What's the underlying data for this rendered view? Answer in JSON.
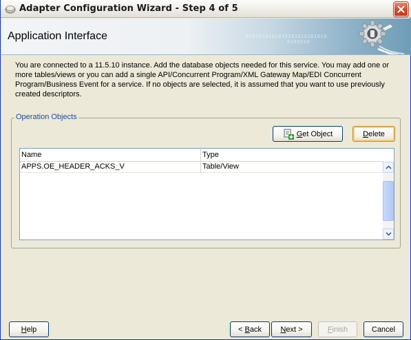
{
  "window": {
    "title": "Adapter Configuration Wizard - Step 4 of 5"
  },
  "banner": {
    "title": "Application Interface",
    "binary_text": "0101010101010101010101010",
    "binary_text_2": "0101010"
  },
  "description": "You are connected to a 11.5.10 instance. Add the database objects needed for this service. You may add one or more tables/views or you can add a single API/Concurrent Program/XML Gateway Map/EDI Concurrent Program/Business Event for a service. If no objects are selected, it is assumed that you want to use previously created descriptors.",
  "operation_objects": {
    "legend": "Operation Objects",
    "get_object_label": "Get Object",
    "get_object_mnemonic": "G",
    "get_object_rest": "et Object",
    "delete_label": "Delete",
    "delete_mnemonic": "D",
    "delete_rest": "elete",
    "table": {
      "columns": [
        "Name",
        "Type"
      ],
      "rows": [
        {
          "name": "APPS.OE_HEADER_ACKS_V",
          "type": "Table/View"
        }
      ]
    }
  },
  "footer": {
    "help_mnemonic": "H",
    "help_rest": "elp",
    "back_prefix": "< ",
    "back_mnemonic": "B",
    "back_rest": "ack",
    "next_mnemonic": "N",
    "next_rest": "ext >",
    "finish_mnemonic": "F",
    "finish_rest": "inish",
    "cancel_label": "Cancel"
  },
  "icons": {
    "title_icon": "oracle-jdeveloper-icon",
    "close_icon": "close-icon",
    "banner_icon": "plug-gear-icon",
    "get_object_icon": "add-object-icon"
  }
}
